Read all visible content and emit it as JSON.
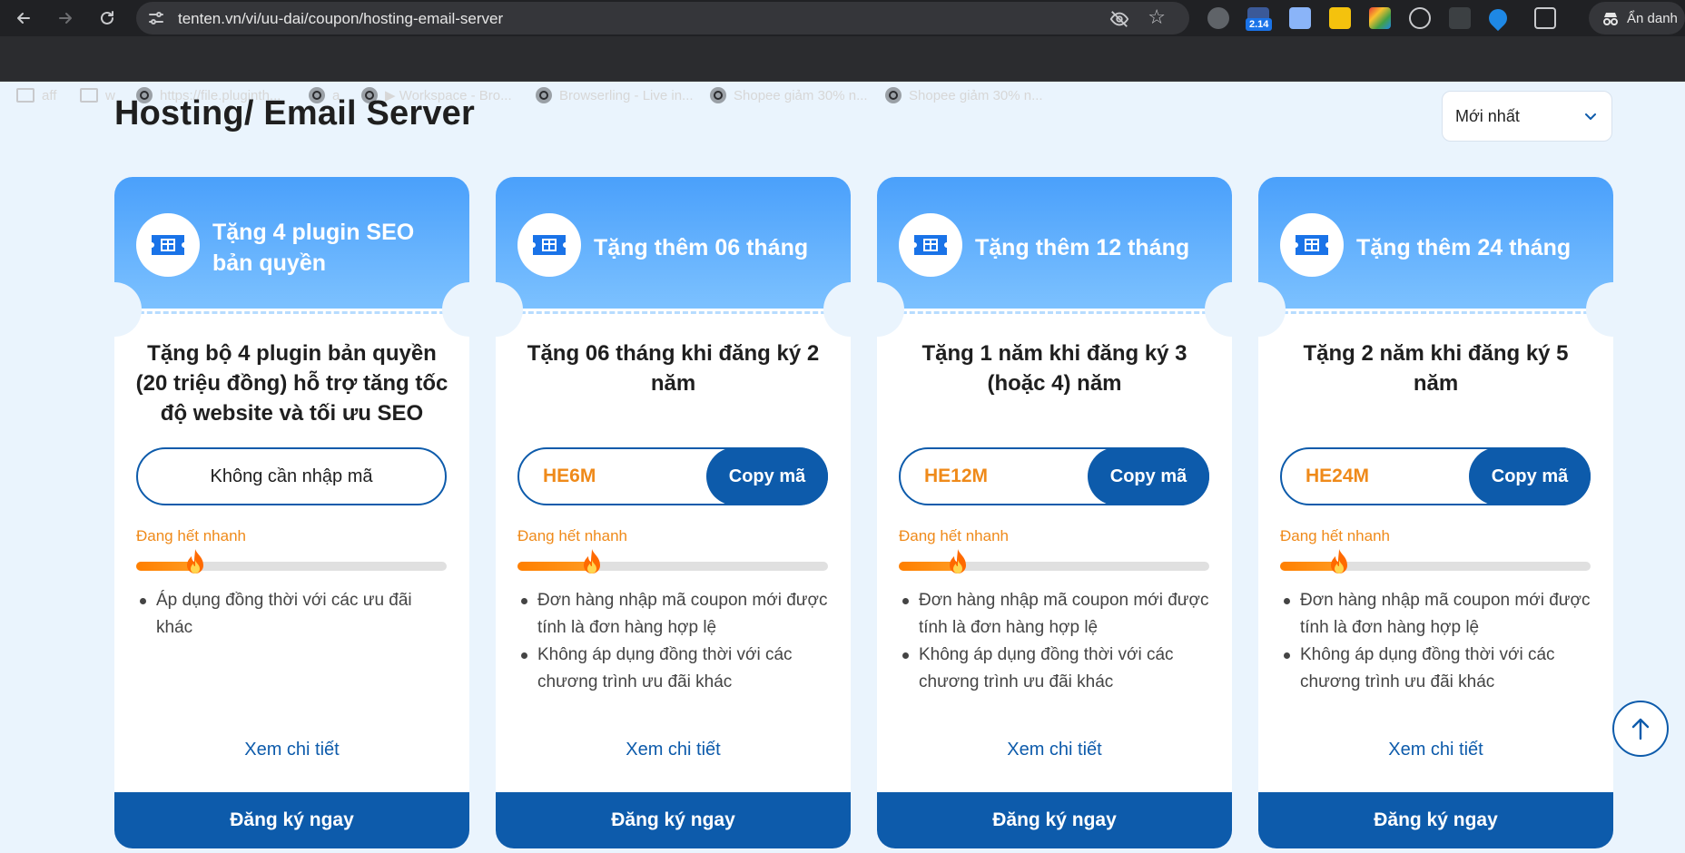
{
  "browser": {
    "url": "tenten.vn/vi/uu-dai/coupon/hosting-email-server",
    "extension_badge": "2.14",
    "profile_label": "Ẩn danh",
    "bookmarks": [
      {
        "label": "aff",
        "icon": "folder-icon"
      },
      {
        "label": "w",
        "icon": "folder-icon"
      },
      {
        "label": "https://file.pluginth...",
        "icon": "globe-icon"
      },
      {
        "label": "a",
        "icon": "globe-icon"
      },
      {
        "label": "▶ Workspace - Bro...",
        "icon": "globe-icon"
      },
      {
        "label": "Browserling - Live in...",
        "icon": "globe-icon"
      },
      {
        "label": "Shopee giảm 30% n...",
        "icon": "globe-icon"
      },
      {
        "label": "Shopee giảm 30% n...",
        "icon": "globe-icon"
      }
    ]
  },
  "page": {
    "title": "Hosting/ Email Server",
    "sort": {
      "selected": "Mới nhất"
    }
  },
  "theme": {
    "accent": "#0d5bab",
    "header_gradient_top": "#4aa0fb",
    "header_gradient_bottom": "#7cc1ff",
    "hot": "#ef8a1a",
    "background": "#eaf4fd"
  },
  "cards": [
    {
      "head_title": "Tặng 4 plugin SEO bản quyền",
      "description": "Tặng bộ 4 plugin bản quyền (20 triệu đồng) hỗ trợ tăng tốc độ website và tối ưu SEO",
      "no_code_label": "Không cần nhập mã",
      "hot_label": "Đang hết nhanh",
      "progress": 0.19,
      "conditions": [
        "Áp dụng đồng thời với các ưu đãi khác"
      ],
      "detail_link": "Xem chi tiết",
      "register_label": "Đăng ký ngay"
    },
    {
      "head_title": "Tặng thêm 06 tháng",
      "description": "Tặng 06 tháng khi đăng ký 2 năm",
      "code": "HE6M",
      "copy_label": "Copy mã",
      "hot_label": "Đang hết nhanh",
      "progress": 0.24,
      "conditions": [
        "Đơn hàng nhập mã coupon mới được tính là đơn hàng hợp lệ",
        "Không áp dụng đồng thời với các chương trình ưu đãi khác"
      ],
      "detail_link": "Xem chi tiết",
      "register_label": "Đăng ký ngay"
    },
    {
      "head_title": "Tặng thêm 12 tháng",
      "description": "Tặng 1 năm khi đăng ký 3 (hoặc 4) năm",
      "code": "HE12M",
      "copy_label": "Copy mã",
      "hot_label": "Đang hết nhanh",
      "progress": 0.19,
      "conditions": [
        "Đơn hàng nhập mã coupon mới được tính là đơn hàng hợp lệ",
        "Không áp dụng đồng thời với các chương trình ưu đãi khác"
      ],
      "detail_link": "Xem chi tiết",
      "register_label": "Đăng ký ngay"
    },
    {
      "head_title": "Tặng thêm 24 tháng",
      "description": "Tặng 2 năm khi đăng ký 5 năm",
      "code": "HE24M",
      "copy_label": "Copy mã",
      "hot_label": "Đang hết nhanh",
      "progress": 0.19,
      "conditions": [
        "Đơn hàng nhập mã coupon mới được tính là đơn hàng hợp lệ",
        "Không áp dụng đồng thời với các chương trình ưu đãi khác"
      ],
      "detail_link": "Xem chi tiết",
      "register_label": "Đăng ký ngay"
    }
  ]
}
